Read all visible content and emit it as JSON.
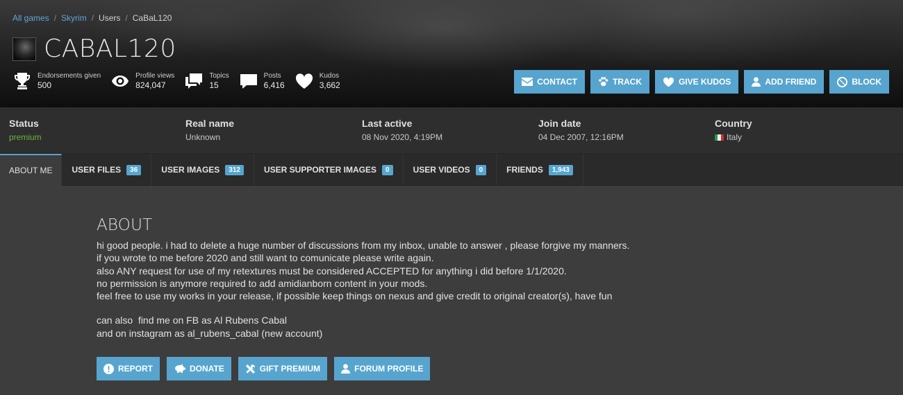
{
  "breadcrumb": {
    "items": [
      "All games",
      "Skyrim",
      "Users",
      "CaBaL120"
    ],
    "separator": "/"
  },
  "profile": {
    "username": "CABAL120"
  },
  "stats": [
    {
      "label": "Endorsements given",
      "value": "500",
      "icon": "trophy-icon"
    },
    {
      "label": "Profile views",
      "value": "824,047",
      "icon": "eye-icon"
    },
    {
      "label": "Topics",
      "value": "15",
      "icon": "topics-icon"
    },
    {
      "label": "Posts",
      "value": "6,416",
      "icon": "speech-bubble-icon"
    },
    {
      "label": "Kudos",
      "value": "3,662",
      "icon": "heart-icon"
    }
  ],
  "actions": {
    "contact": "CONTACT",
    "track": "TRACK",
    "give_kudos": "GIVE KUDOS",
    "add_friend": "ADD FRIEND",
    "block": "BLOCK"
  },
  "info": {
    "status_label": "Status",
    "status_value": "premium",
    "real_name_label": "Real name",
    "real_name_value": "Unknown",
    "last_active_label": "Last active",
    "last_active_value": "08 Nov 2020,  4:19PM",
    "join_date_label": "Join date",
    "join_date_value": "04 Dec 2007,  12:16PM",
    "country_label": "Country",
    "country_value": "Italy"
  },
  "tabs": [
    {
      "label": "ABOUT ME",
      "count": null,
      "active": true
    },
    {
      "label": "USER FILES",
      "count": "36"
    },
    {
      "label": "USER IMAGES",
      "count": "312"
    },
    {
      "label": "USER SUPPORTER IMAGES",
      "count": "0"
    },
    {
      "label": "USER VIDEOS",
      "count": "0"
    },
    {
      "label": "FRIENDS",
      "count": "1,943"
    }
  ],
  "about": {
    "heading": "ABOUT",
    "lines": [
      "hi good people. i had to delete a huge number of discussions from my inbox, unable to answer , please forgive my manners.",
      "if you wrote to me before 2020 and still want to comunicate please write again.",
      "also ANY request for use of my retextures must be considered ACCEPTED for anything i did before 1/1/2020.",
      "no permission is anymore required to add amidianborn content in your mods.",
      "feel free to use my works in your release, if possible keep things on nexus and give credit to original creator(s), have fun",
      "can also  find me on FB as Al Rubens Cabal",
      "and on instagram as al_rubens_cabal (new account)"
    ]
  },
  "bottom_actions": {
    "report": "REPORT",
    "donate": "DONATE",
    "gift_premium": "GIFT PREMIUM",
    "forum_profile": "FORUM PROFILE"
  },
  "colors": {
    "accent": "#57a5cf",
    "premium": "#6bb33b",
    "link": "#5ea6d6"
  }
}
